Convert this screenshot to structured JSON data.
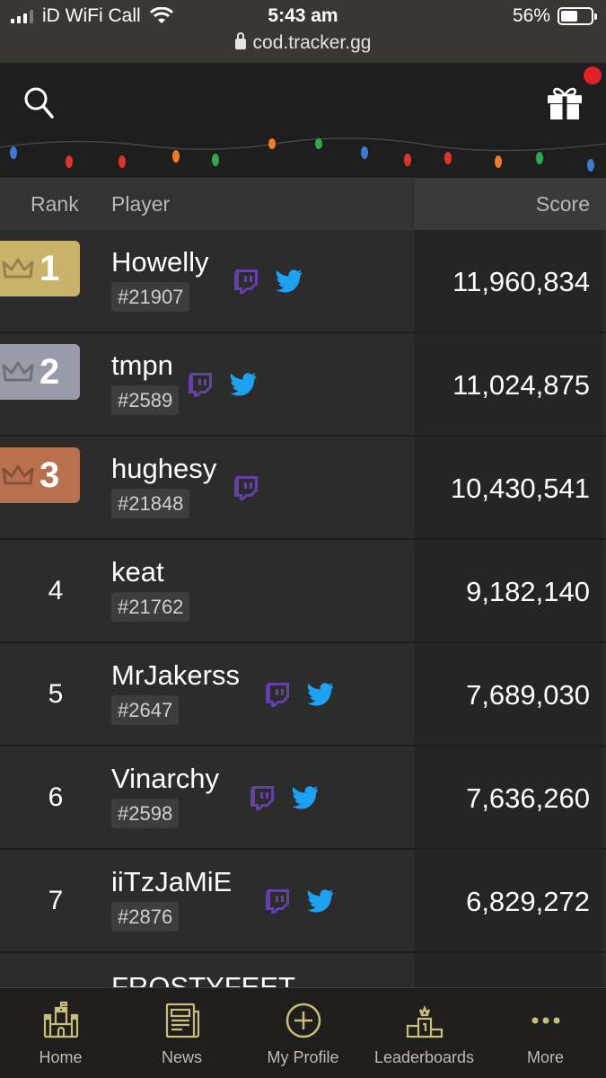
{
  "status_bar": {
    "carrier": "iD WiFi Call",
    "time": "5:43 am",
    "battery": "56%",
    "battery_level": 0.56,
    "url": "cod.tracker.gg"
  },
  "header": {
    "search_icon": "search-icon",
    "gift_icon": "gift-icon"
  },
  "table": {
    "columns": {
      "rank": "Rank",
      "player": "Player",
      "score": "Score"
    },
    "rows": [
      {
        "rank": "1",
        "name": "Howelly",
        "tag": "#21907",
        "twitch": true,
        "twitter": true,
        "score": "11,960,834",
        "badge_color": "#c9b36a"
      },
      {
        "rank": "2",
        "name": "tmpn",
        "tag": "#2589",
        "twitch": true,
        "twitter": true,
        "score": "11,024,875",
        "badge_color": "#9a9aaa"
      },
      {
        "rank": "3",
        "name": "hughesy",
        "tag": "#21848",
        "twitch": true,
        "twitter": false,
        "score": "10,430,541",
        "badge_color": "#b9704e"
      },
      {
        "rank": "4",
        "name": "keat",
        "tag": "#21762",
        "twitch": false,
        "twitter": false,
        "score": "9,182,140"
      },
      {
        "rank": "5",
        "name": "MrJakerss",
        "tag": "#2647",
        "twitch": true,
        "twitter": true,
        "score": "7,689,030"
      },
      {
        "rank": "6",
        "name": "Vinarchy",
        "tag": "#2598",
        "twitch": true,
        "twitter": true,
        "score": "7,636,260"
      },
      {
        "rank": "7",
        "name": "iiTzJaMiE",
        "tag": "#2876",
        "twitch": true,
        "twitter": true,
        "score": "6,829,272"
      }
    ],
    "partial_row_name": "FROSTYFEET"
  },
  "bottom_nav": {
    "items": [
      {
        "label": "Home",
        "icon": "castle-icon"
      },
      {
        "label": "News",
        "icon": "newspaper-icon"
      },
      {
        "label": "My Profile",
        "icon": "plus-circle-icon"
      },
      {
        "label": "Leaderboards",
        "icon": "podium-icon"
      },
      {
        "label": "More",
        "icon": "more-dots-icon"
      }
    ]
  },
  "colors": {
    "twitch": "#6441a5",
    "twitter": "#1da1f2",
    "nav_icon": "#c9bd7a",
    "accent_red": "#e02128"
  }
}
